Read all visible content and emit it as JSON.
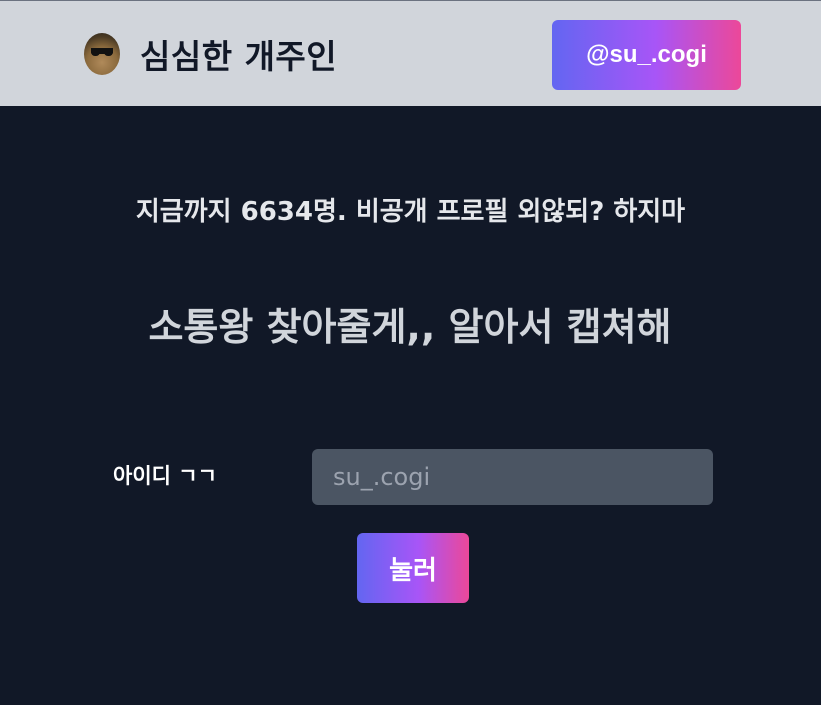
{
  "header": {
    "title": "심심한 개주인",
    "handle_button": "@su_.cogi"
  },
  "main": {
    "counter_text": "지금까지 6634명. 비공개 프로필 외않되? 하지마",
    "headline": "소통왕 찾아줄게,, 알아서 캡쳐해",
    "id_label": "아이디 ㄱㄱ",
    "id_input": {
      "value": "",
      "placeholder": "su_.cogi"
    },
    "submit_label": "눌러"
  },
  "colors": {
    "background": "#111827",
    "topbar": "#d1d5db",
    "gradient_start": "#6366f1",
    "gradient_end": "#ec4899",
    "input_bg": "#4b5563"
  },
  "icons": {
    "avatar": "dog-with-sunglasses-avatar"
  }
}
